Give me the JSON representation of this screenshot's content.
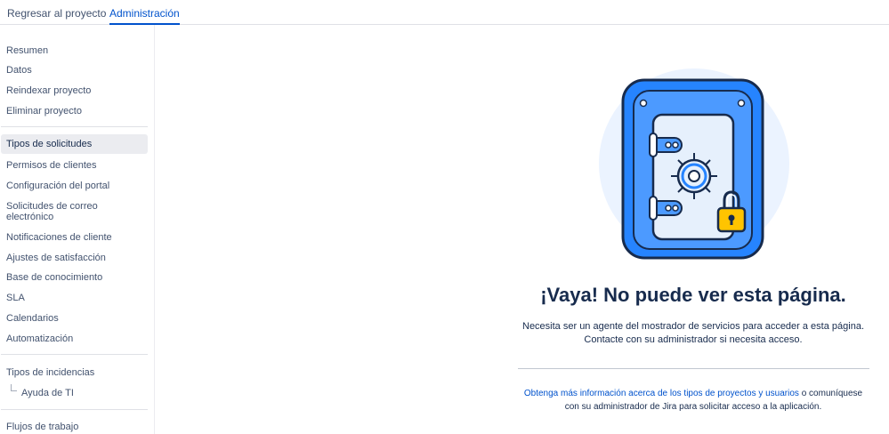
{
  "topbar": {
    "back_label": "Regresar al proyecto",
    "admin_label": "Administración"
  },
  "sidebar": {
    "group1": [
      "Resumen",
      "Datos",
      "Reindexar proyecto",
      "Eliminar proyecto"
    ],
    "group2": [
      "Tipos de solicitudes",
      "Permisos de clientes",
      "Configuración del portal",
      "Solicitudes de correo electrónico",
      "Notificaciones de cliente",
      "Ajustes de satisfacción",
      "Base de conocimiento",
      "SLA",
      "Calendarios",
      "Automatización"
    ],
    "issue_types": "Tipos de incidencias",
    "issue_type_child": "Ayuda de TI",
    "workflows": "Flujos de trabajo",
    "selected": "Tipos de solicitudes"
  },
  "main": {
    "title": "¡Vaya! No puede ver esta página.",
    "message_line1": "Necesita ser un agente del mostrador de servicios para acceder a esta página.",
    "message_line2": "Contacte con su administrador si necesita acceso.",
    "link_text": "Obtenga más información acerca de los tipos de proyectos y usuarios",
    "footer_after_link": " o comuníquese",
    "footer_line2": "con su administrador de Jira para solicitar acceso a la aplicación."
  },
  "colors": {
    "accent": "#0052cc",
    "vault_blue": "#2684ff",
    "vault_light": "#deebff",
    "lock_yellow": "#ffc400"
  }
}
